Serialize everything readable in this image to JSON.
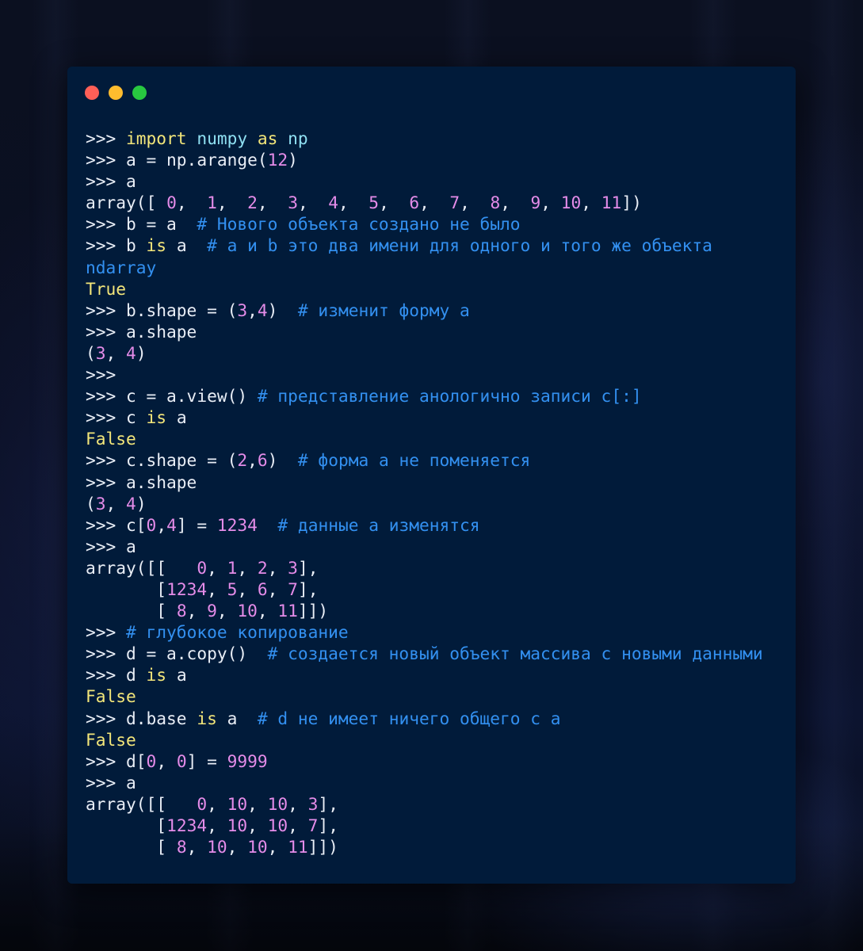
{
  "colors": {
    "window_bg": "#011b3a",
    "default": "#e9eef6",
    "keyword": "#f3e67a",
    "number": "#e58ce9",
    "comment": "#3390f0",
    "bool": "#f3e67a",
    "ident": "#8fe0f2",
    "dot_close": "#fe5f57",
    "dot_minimize": "#febc2e",
    "dot_maximize": "#28c840"
  },
  "window_controls": [
    {
      "name": "close",
      "icon": "close-dot-icon"
    },
    {
      "name": "minimize",
      "icon": "minimize-dot-icon"
    },
    {
      "name": "maximize",
      "icon": "maximize-dot-icon"
    }
  ],
  "code_lines": [
    [
      [
        "d",
        ">>> "
      ],
      [
        "k",
        "import"
      ],
      [
        "d",
        " "
      ],
      [
        "i",
        "numpy"
      ],
      [
        "d",
        " "
      ],
      [
        "k",
        "as"
      ],
      [
        "d",
        " "
      ],
      [
        "i",
        "np"
      ]
    ],
    [
      [
        "d",
        ">>> a = np.arange("
      ],
      [
        "n",
        "12"
      ],
      [
        "d",
        ")"
      ]
    ],
    [
      [
        "d",
        ">>> a"
      ]
    ],
    [
      [
        "d",
        "array([ "
      ],
      [
        "n",
        "0"
      ],
      [
        "d",
        ",  "
      ],
      [
        "n",
        "1"
      ],
      [
        "d",
        ",  "
      ],
      [
        "n",
        "2"
      ],
      [
        "d",
        ",  "
      ],
      [
        "n",
        "3"
      ],
      [
        "d",
        ",  "
      ],
      [
        "n",
        "4"
      ],
      [
        "d",
        ",  "
      ],
      [
        "n",
        "5"
      ],
      [
        "d",
        ",  "
      ],
      [
        "n",
        "6"
      ],
      [
        "d",
        ",  "
      ],
      [
        "n",
        "7"
      ],
      [
        "d",
        ",  "
      ],
      [
        "n",
        "8"
      ],
      [
        "d",
        ",  "
      ],
      [
        "n",
        "9"
      ],
      [
        "d",
        ", "
      ],
      [
        "n",
        "10"
      ],
      [
        "d",
        ", "
      ],
      [
        "n",
        "11"
      ],
      [
        "d",
        "])"
      ]
    ],
    [
      [
        "d",
        ">>> b = a  "
      ],
      [
        "c",
        "# Нового объекта создано не было"
      ]
    ],
    [
      [
        "d",
        ">>> b "
      ],
      [
        "k",
        "is"
      ],
      [
        "d",
        " a  "
      ],
      [
        "c",
        "# a и b это два имени для одного и того же объекта"
      ]
    ],
    [
      [
        "c",
        "ndarray"
      ]
    ],
    [
      [
        "b",
        "True"
      ]
    ],
    [
      [
        "d",
        ">>> b.shape = ("
      ],
      [
        "n",
        "3"
      ],
      [
        "d",
        ","
      ],
      [
        "n",
        "4"
      ],
      [
        "d",
        ")  "
      ],
      [
        "c",
        "# изменит форму a"
      ]
    ],
    [
      [
        "d",
        ">>> a.shape"
      ]
    ],
    [
      [
        "d",
        "("
      ],
      [
        "n",
        "3"
      ],
      [
        "d",
        ", "
      ],
      [
        "n",
        "4"
      ],
      [
        "d",
        ")"
      ]
    ],
    [
      [
        "d",
        ">>>"
      ]
    ],
    [
      [
        "d",
        ">>> c = a.view() "
      ],
      [
        "c",
        "# представление анологично записи c[:]"
      ]
    ],
    [
      [
        "d",
        ">>> c "
      ],
      [
        "k",
        "is"
      ],
      [
        "d",
        " a"
      ]
    ],
    [
      [
        "b",
        "False"
      ]
    ],
    [
      [
        "d",
        ">>> c.shape = ("
      ],
      [
        "n",
        "2"
      ],
      [
        "d",
        ","
      ],
      [
        "n",
        "6"
      ],
      [
        "d",
        ")  "
      ],
      [
        "c",
        "# форма a не поменяется"
      ]
    ],
    [
      [
        "d",
        ">>> a.shape"
      ]
    ],
    [
      [
        "d",
        "("
      ],
      [
        "n",
        "3"
      ],
      [
        "d",
        ", "
      ],
      [
        "n",
        "4"
      ],
      [
        "d",
        ")"
      ]
    ],
    [
      [
        "d",
        ">>> c["
      ],
      [
        "n",
        "0"
      ],
      [
        "d",
        ","
      ],
      [
        "n",
        "4"
      ],
      [
        "d",
        "] = "
      ],
      [
        "n",
        "1234"
      ],
      [
        "d",
        "  "
      ],
      [
        "c",
        "# данные a изменятся"
      ]
    ],
    [
      [
        "d",
        ">>> a"
      ]
    ],
    [
      [
        "d",
        "array([[   "
      ],
      [
        "n",
        "0"
      ],
      [
        "d",
        ", "
      ],
      [
        "n",
        "1"
      ],
      [
        "d",
        ", "
      ],
      [
        "n",
        "2"
      ],
      [
        "d",
        ", "
      ],
      [
        "n",
        "3"
      ],
      [
        "d",
        "],"
      ]
    ],
    [
      [
        "d",
        "       ["
      ],
      [
        "n",
        "1234"
      ],
      [
        "d",
        ", "
      ],
      [
        "n",
        "5"
      ],
      [
        "d",
        ", "
      ],
      [
        "n",
        "6"
      ],
      [
        "d",
        ", "
      ],
      [
        "n",
        "7"
      ],
      [
        "d",
        "],"
      ]
    ],
    [
      [
        "d",
        "       [ "
      ],
      [
        "n",
        "8"
      ],
      [
        "d",
        ", "
      ],
      [
        "n",
        "9"
      ],
      [
        "d",
        ", "
      ],
      [
        "n",
        "10"
      ],
      [
        "d",
        ", "
      ],
      [
        "n",
        "11"
      ],
      [
        "d",
        "]])"
      ]
    ],
    [
      [
        "d",
        ">>> "
      ],
      [
        "c",
        "# глубокое копирование"
      ]
    ],
    [
      [
        "d",
        ">>> d = a.copy()  "
      ],
      [
        "c",
        "# создается новый объект массива с новыми данными"
      ]
    ],
    [
      [
        "d",
        ">>> d "
      ],
      [
        "k",
        "is"
      ],
      [
        "d",
        " a"
      ]
    ],
    [
      [
        "b",
        "False"
      ]
    ],
    [
      [
        "d",
        ">>> d.base "
      ],
      [
        "k",
        "is"
      ],
      [
        "d",
        " a  "
      ],
      [
        "c",
        "# d не имеет ничего общего с a"
      ]
    ],
    [
      [
        "b",
        "False"
      ]
    ],
    [
      [
        "d",
        ">>> d["
      ],
      [
        "n",
        "0"
      ],
      [
        "d",
        ", "
      ],
      [
        "n",
        "0"
      ],
      [
        "d",
        "] = "
      ],
      [
        "n",
        "9999"
      ]
    ],
    [
      [
        "d",
        ">>> a"
      ]
    ],
    [
      [
        "d",
        "array([[   "
      ],
      [
        "n",
        "0"
      ],
      [
        "d",
        ", "
      ],
      [
        "n",
        "10"
      ],
      [
        "d",
        ", "
      ],
      [
        "n",
        "10"
      ],
      [
        "d",
        ", "
      ],
      [
        "n",
        "3"
      ],
      [
        "d",
        "],"
      ]
    ],
    [
      [
        "d",
        "       ["
      ],
      [
        "n",
        "1234"
      ],
      [
        "d",
        ", "
      ],
      [
        "n",
        "10"
      ],
      [
        "d",
        ", "
      ],
      [
        "n",
        "10"
      ],
      [
        "d",
        ", "
      ],
      [
        "n",
        "7"
      ],
      [
        "d",
        "],"
      ]
    ],
    [
      [
        "d",
        "       [ "
      ],
      [
        "n",
        "8"
      ],
      [
        "d",
        ", "
      ],
      [
        "n",
        "10"
      ],
      [
        "d",
        ", "
      ],
      [
        "n",
        "10"
      ],
      [
        "d",
        ", "
      ],
      [
        "n",
        "11"
      ],
      [
        "d",
        "]])"
      ]
    ]
  ]
}
